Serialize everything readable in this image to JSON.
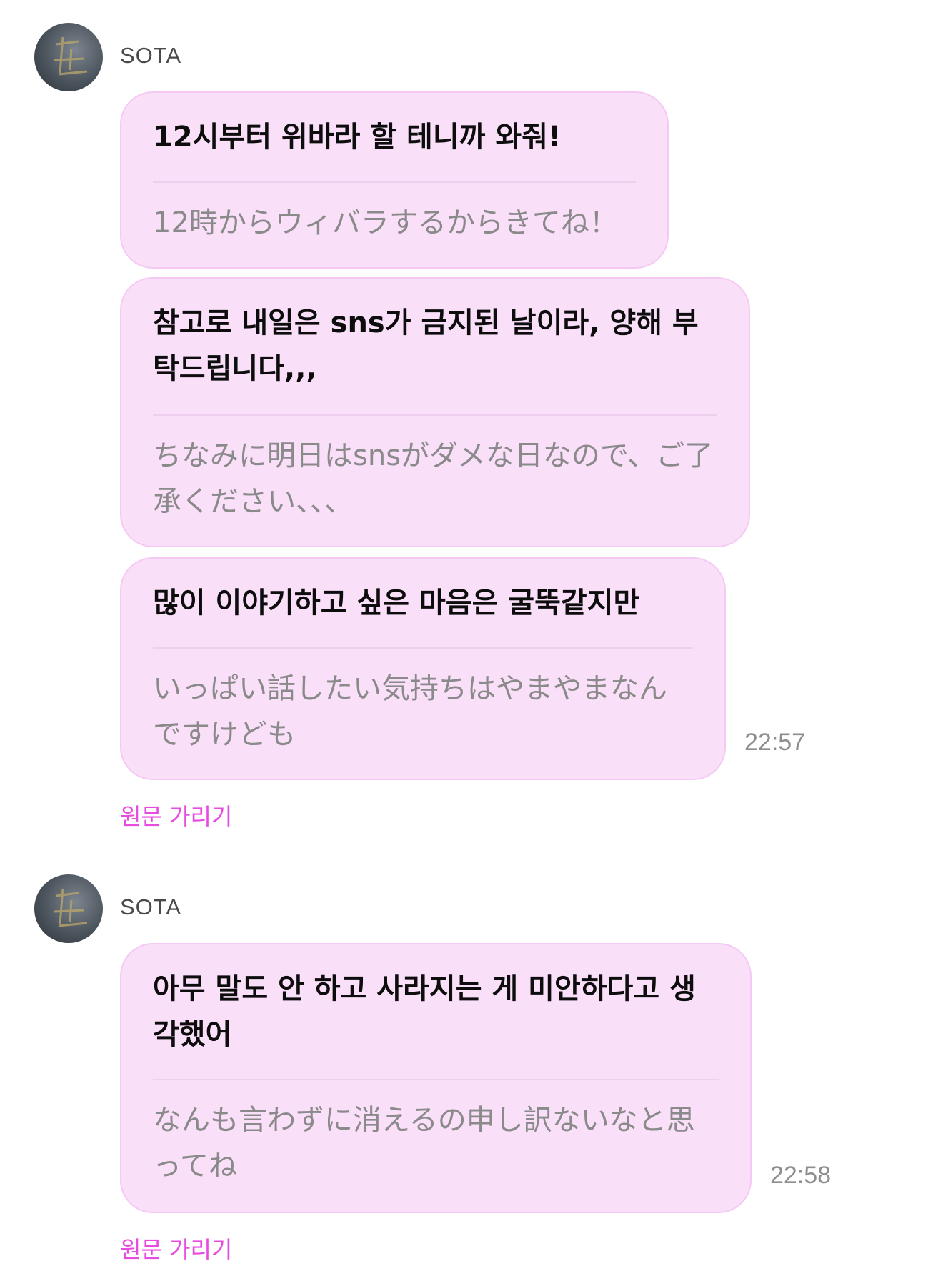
{
  "colors": {
    "bubble_bg": "#fadff9",
    "bubble_border": "#f4c9f4",
    "link": "#e84be0",
    "translation_text": "#8a8a8a"
  },
  "groups": [
    {
      "sender": "SOTA",
      "avatar_icon": "avatar-profile-icon",
      "messages": [
        {
          "original": "12시부터 위바라 할 테니까 와줘!",
          "translation": "12時からウィバラするからきてね！"
        },
        {
          "original": "참고로 내일은 sns가 금지된 날이라, 양해 부탁드립니다,,,",
          "translation": "ちなみに明日はsnsがダメな日なので、ご了承ください、、、"
        },
        {
          "original": "많이 이야기하고 싶은 마음은 굴뚝같지만",
          "translation": "いっぱい話したい気持ちはやまやまなんですけども"
        }
      ],
      "time": "22:57",
      "hide_label": "원문 가리기"
    },
    {
      "sender": "SOTA",
      "avatar_icon": "avatar-profile-icon",
      "messages": [
        {
          "original": "아무 말도 안 하고 사라지는 게 미안하다고 생각했어",
          "translation": "なんも言わずに消えるの申し訳ないなと思ってね"
        }
      ],
      "time": "22:58",
      "hide_label": "원문 가리기"
    }
  ]
}
